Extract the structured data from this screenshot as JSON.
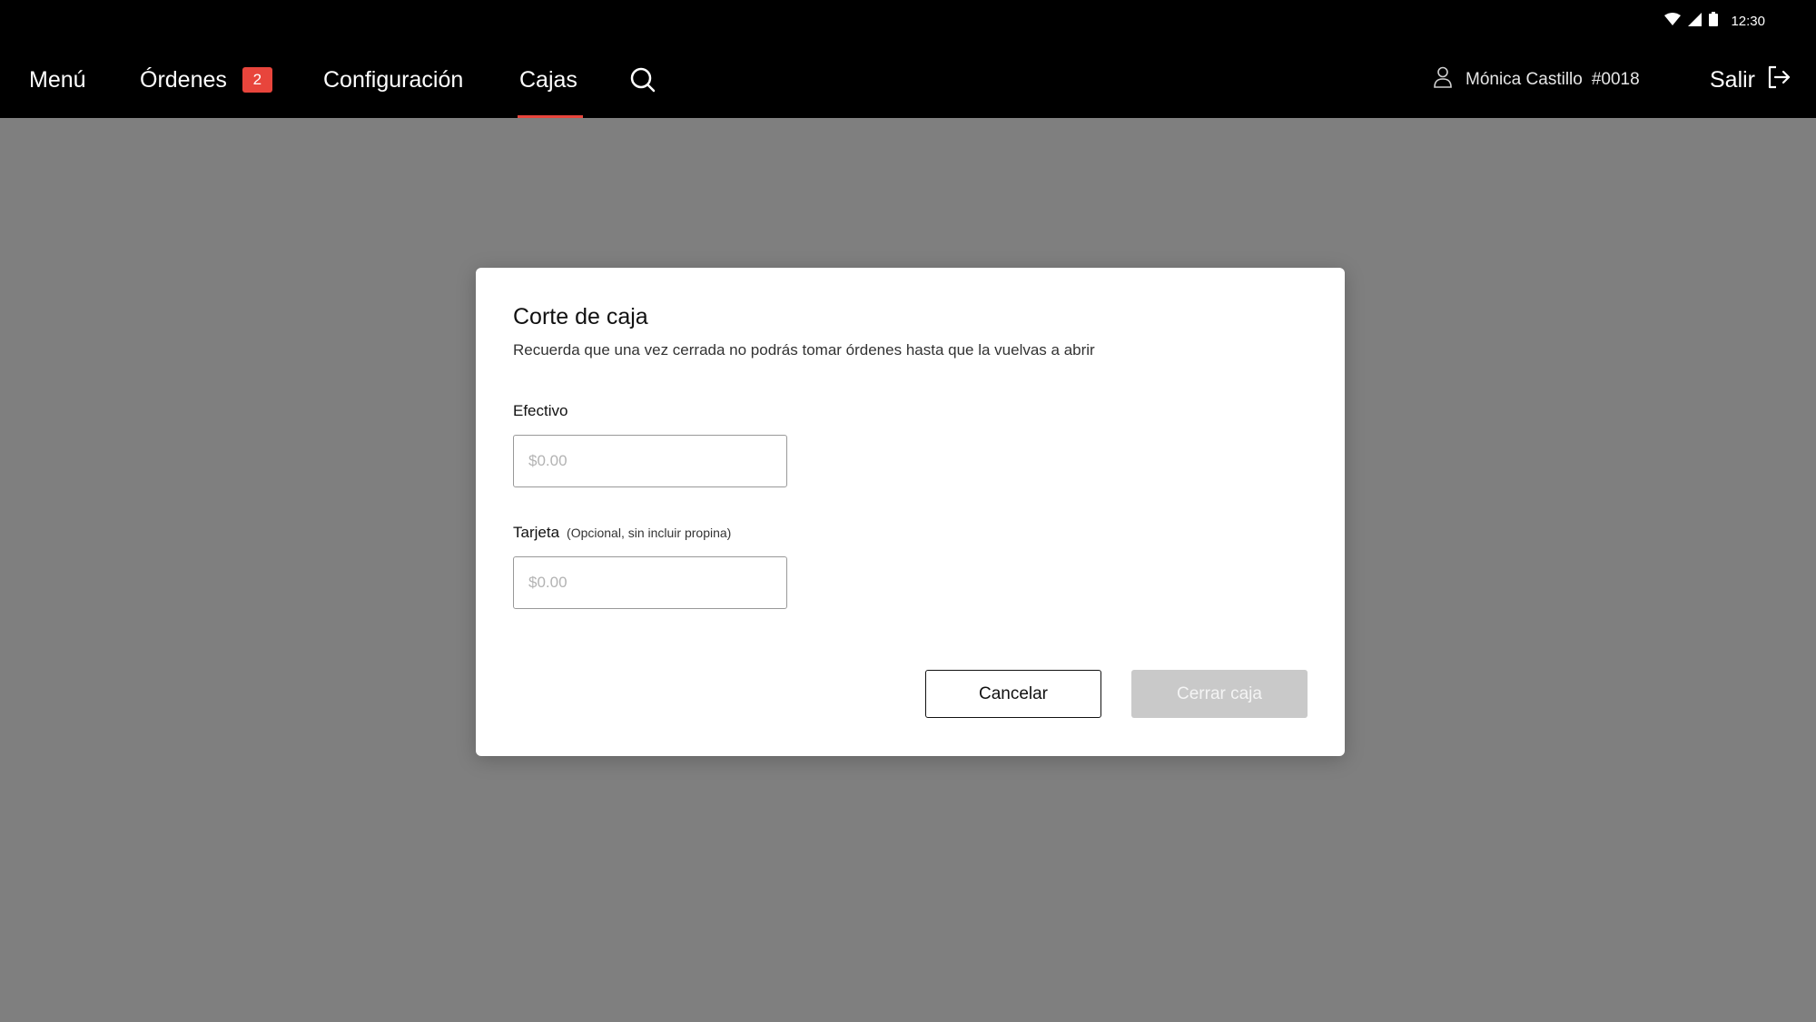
{
  "status_bar": {
    "time": "12:30",
    "icons": [
      "wifi-icon",
      "signal-icon",
      "battery-icon"
    ]
  },
  "nav": {
    "items": [
      {
        "label": "Menú"
      },
      {
        "label": "Órdenes",
        "badge": "2"
      },
      {
        "label": "Configuración"
      },
      {
        "label": "Cajas",
        "active": true
      }
    ],
    "search_icon": "search-icon",
    "user": {
      "name": "Mónica Castillo",
      "code": "#0018"
    },
    "logout_label": "Salir"
  },
  "modal": {
    "title": "Corte de caja",
    "description": "Recuerda que una vez cerrada no podrás tomar órdenes hasta que la vuelvas a abrir",
    "fields": [
      {
        "label": "Efectivo",
        "placeholder": "$0.00",
        "value": ""
      },
      {
        "label": "Tarjeta",
        "note": "(Opcional, sin incluir propina)",
        "placeholder": "$0.00",
        "value": ""
      }
    ],
    "cancel_label": "Cancelar",
    "submit_label": "Cerrar caja"
  },
  "colors": {
    "accent": "#e8453c",
    "nav_background": "#000000",
    "overlay": "#7f7f7f",
    "disabled_button": "#c9c9c9"
  }
}
